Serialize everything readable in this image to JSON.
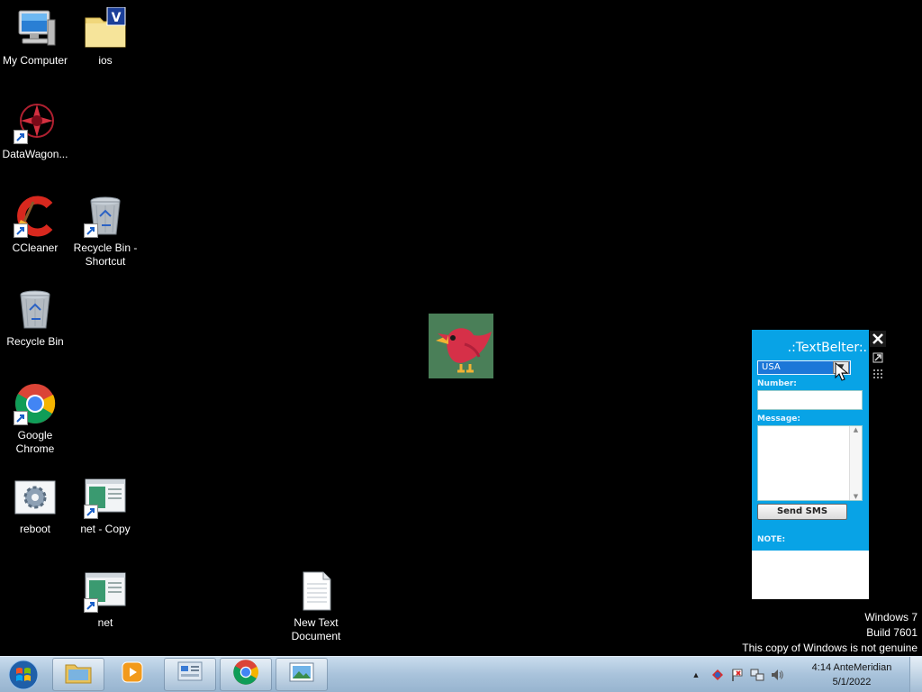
{
  "desktop_icons": [
    {
      "label": "My Computer",
      "icon": "computer-icon"
    },
    {
      "label": "ios",
      "icon": "folder-icon"
    },
    {
      "label": "DataWagon...",
      "icon": "datawagon-icon"
    },
    {
      "label": "CCleaner",
      "icon": "ccleaner-icon"
    },
    {
      "label": "Recycle Bin -\nShortcut",
      "icon": "recycle-bin-icon"
    },
    {
      "label": "Recycle Bin",
      "icon": "recycle-bin-icon"
    },
    {
      "label": "Google\nChrome",
      "icon": "chrome-icon"
    },
    {
      "label": "reboot",
      "icon": "settings-gear-icon"
    },
    {
      "label": "net - Copy",
      "icon": "window-app-icon"
    },
    {
      "label": "net",
      "icon": "window-app-icon"
    },
    {
      "label": "New Text\nDocument",
      "icon": "text-document-icon"
    }
  ],
  "gadget": {
    "title": ".:TextBelter:.",
    "country_selected": "USA",
    "number_label": "Number:",
    "number_value": "",
    "message_label": "Message:",
    "message_value": "",
    "send_button": "Send SMS",
    "note_label": "NOTE:",
    "colors": {
      "background": "#08a3e6",
      "select": "#1c77d8"
    }
  },
  "watermark": {
    "line1": "Windows 7",
    "line2": "Build 7601",
    "line3": "This copy of Windows is not genuine"
  },
  "taskbar": {
    "pinned": [
      "windows-explorer-icon",
      "media-player-icon",
      "control-panel-icon",
      "chrome-icon",
      "picture-viewer-icon"
    ],
    "tray_icons": [
      "show-hidden-icons-chevron",
      "tray-app-icon",
      "action-center-flag-icon",
      "network-icon",
      "volume-icon"
    ],
    "clock_time": "4:14 AnteMeridian",
    "clock_date": "5/1/2022"
  }
}
